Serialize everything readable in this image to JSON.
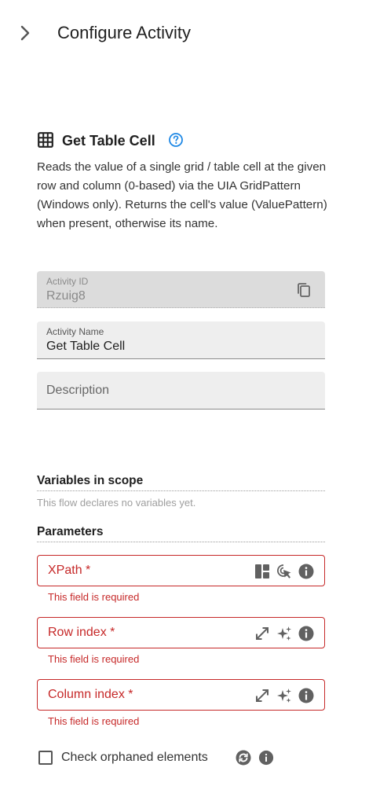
{
  "header": {
    "title": "Configure Activity",
    "collapse_icon": "chevron-right-icon"
  },
  "activity": {
    "title": "Get Table Cell",
    "icon": "table-grid-icon",
    "help_icon": "help-circle-icon",
    "description": "Reads the value of a single grid / table cell at the given row and column (0-based) via the UIA GridPattern (Windows only). Returns the cell's value (ValuePattern) when present, otherwise its name."
  },
  "fields": {
    "activity_id": {
      "label": "Activity ID",
      "value": "Rzuig8",
      "icon": "copy-icon"
    },
    "activity_name": {
      "label": "Activity Name",
      "value": "Get Table Cell"
    },
    "description": {
      "placeholder": "Description"
    }
  },
  "variables": {
    "title": "Variables in scope",
    "note": "This flow declares no variables yet."
  },
  "parameters": {
    "title": "Parameters",
    "xpath": {
      "label": "XPath *",
      "error": "This field is required",
      "icons": [
        "layout-icon",
        "element-picker-icon",
        "info-icon"
      ]
    },
    "row_index": {
      "label": "Row index *",
      "error": "This field is required",
      "icons": [
        "expand-icon",
        "sparkle-icon",
        "info-icon"
      ]
    },
    "column_index": {
      "label": "Column index *",
      "error": "This field is required",
      "icons": [
        "expand-icon",
        "sparkle-icon",
        "info-icon"
      ]
    }
  },
  "orphaned": {
    "label": "Check orphaned elements",
    "checked": false,
    "icons": [
      "refresh-icon",
      "info-icon"
    ]
  },
  "colors": {
    "error": "#c62828",
    "help": "#1e88e5",
    "field_bg": "#eeeeee",
    "disabled_bg": "#dcdcdc"
  }
}
